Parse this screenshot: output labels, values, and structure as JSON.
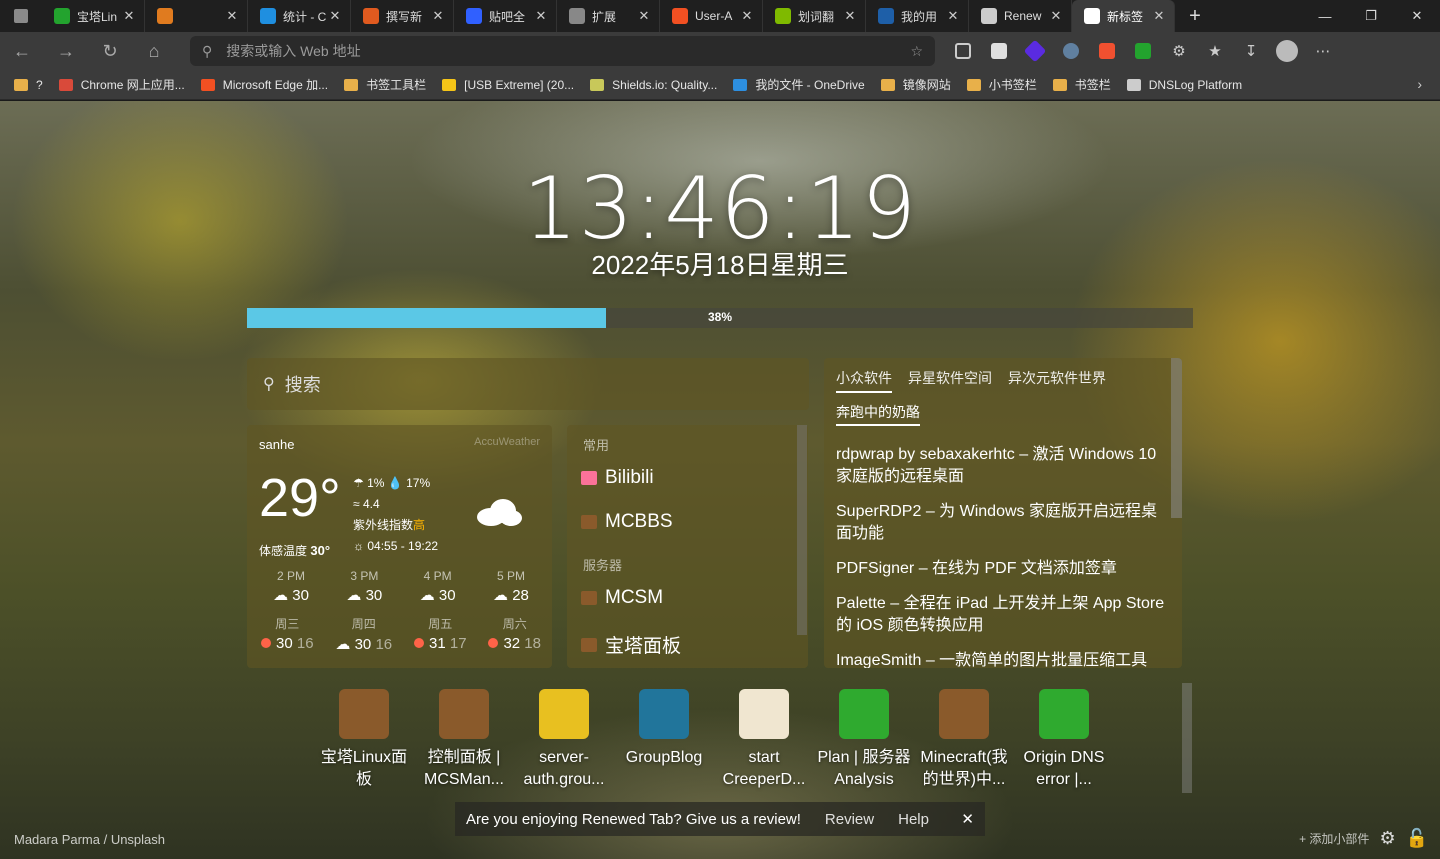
{
  "tabs": [
    {
      "title": "宝塔Lin",
      "color": "#23a32e"
    },
    {
      "title": "",
      "color": "#e07b1f"
    },
    {
      "title": "统计 - C",
      "color": "#1f8fe0"
    },
    {
      "title": "撰写新",
      "color": "#e05a1f"
    },
    {
      "title": "贴吧全",
      "color": "#3060ff"
    },
    {
      "title": "扩展",
      "color": "#888888"
    },
    {
      "title": "User-A",
      "color": "#f25022"
    },
    {
      "title": "划词翻",
      "color": "#7fba00"
    },
    {
      "title": "我的用",
      "color": "#1e5fa8"
    },
    {
      "title": "Renew",
      "color": "#cccccc"
    },
    {
      "title": "新标签",
      "color": "#ffffff",
      "active": true
    }
  ],
  "omnibox": {
    "placeholder": "搜索或输入 Web 地址"
  },
  "bookmarks": [
    {
      "label": "?",
      "color": "#e8b04a"
    },
    {
      "label": "Chrome 网上应用...",
      "color": "#d94a3a"
    },
    {
      "label": "Microsoft Edge 加...",
      "color": "#f25022"
    },
    {
      "label": "书签工具栏",
      "color": "#e8b04a"
    },
    {
      "label": "[USB Extreme] (20...",
      "color": "#f5c518"
    },
    {
      "label": "Shields.io: Quality...",
      "color": "#c8c85a"
    },
    {
      "label": "我的文件 - OneDrive",
      "color": "#2d8fe0"
    },
    {
      "label": "镜像网站",
      "color": "#e8b04a"
    },
    {
      "label": "小书签栏",
      "color": "#e8b04a"
    },
    {
      "label": "书签栏",
      "color": "#e8b04a"
    },
    {
      "label": "DNSLog Platform",
      "color": "#cccccc"
    }
  ],
  "clock": {
    "time": "13:46:19",
    "date": "2022年5月18日星期三"
  },
  "progress": {
    "label": "38%",
    "value": 0.38
  },
  "search": {
    "placeholder": "搜索"
  },
  "weather": {
    "location": "sanhe",
    "source": "AccuWeather",
    "temp": "29°",
    "feels_label": "体感温度",
    "feels_value": "30°",
    "rain": "1%",
    "humidity": "17%",
    "wind": "4.4",
    "uv_label": "紫外线指数",
    "uv_value": "高",
    "sun": "04:55 - 19:22",
    "hourly": [
      {
        "hour": "2 PM",
        "temp": "30"
      },
      {
        "hour": "3 PM",
        "temp": "30"
      },
      {
        "hour": "4 PM",
        "temp": "30"
      },
      {
        "hour": "5 PM",
        "temp": "28"
      }
    ],
    "daily": [
      {
        "day": "周三",
        "hi": "30",
        "lo": "16",
        "icon": "sun"
      },
      {
        "day": "周四",
        "hi": "30",
        "lo": "16",
        "icon": "cloud"
      },
      {
        "day": "周五",
        "hi": "31",
        "lo": "17",
        "icon": "sun"
      },
      {
        "day": "周六",
        "hi": "32",
        "lo": "18",
        "icon": "sun"
      }
    ]
  },
  "links": {
    "group1": "常用",
    "group2": "服务器",
    "items": [
      "Bilibili",
      "MCBBS",
      "MCSM",
      "宝塔面板"
    ]
  },
  "feed": {
    "tabs": [
      "小众软件",
      "异星软件空间",
      "异次元软件世界"
    ],
    "subtitle": "奔跑中的奶酪",
    "items": [
      "rdpwrap by sebaxakerhtc – 激活 Windows 10 家庭版的远程桌面",
      "SuperRDP2 – 为 Windows 家庭版开启远程桌面功能",
      "PDFSigner – 在线为 PDF 文档添加签章",
      "Palette – 全程在 iPad 上开发并上架 App Store 的 iOS 颜色转换应用",
      "ImageSmith – 一款简单的图片批量压缩工具"
    ]
  },
  "apps": [
    {
      "name": "宝塔Linux面板",
      "color": "#8a5a2b"
    },
    {
      "name": "控制面板 | MCSMan...",
      "color": "#8a5a2b"
    },
    {
      "name": "server-auth.grou...",
      "color": "#e8c020"
    },
    {
      "name": "GroupBlog",
      "color": "#21759b"
    },
    {
      "name": "start CreeperD...",
      "color": "#f0e6d0"
    },
    {
      "name": "Plan | 服务器 Analysis",
      "color": "#2faa2f"
    },
    {
      "name": "Minecraft(我的世界)中...",
      "color": "#8a5a2b"
    },
    {
      "name": "Origin DNS error |...",
      "color": "#2faa2f"
    }
  ],
  "credit": "Madara Parma / Unsplash",
  "toast": {
    "message": "Are you enjoying Renewed Tab? Give us a review!",
    "review": "Review",
    "help": "Help"
  },
  "corner": {
    "add_widget": "+ 添加小部件"
  }
}
